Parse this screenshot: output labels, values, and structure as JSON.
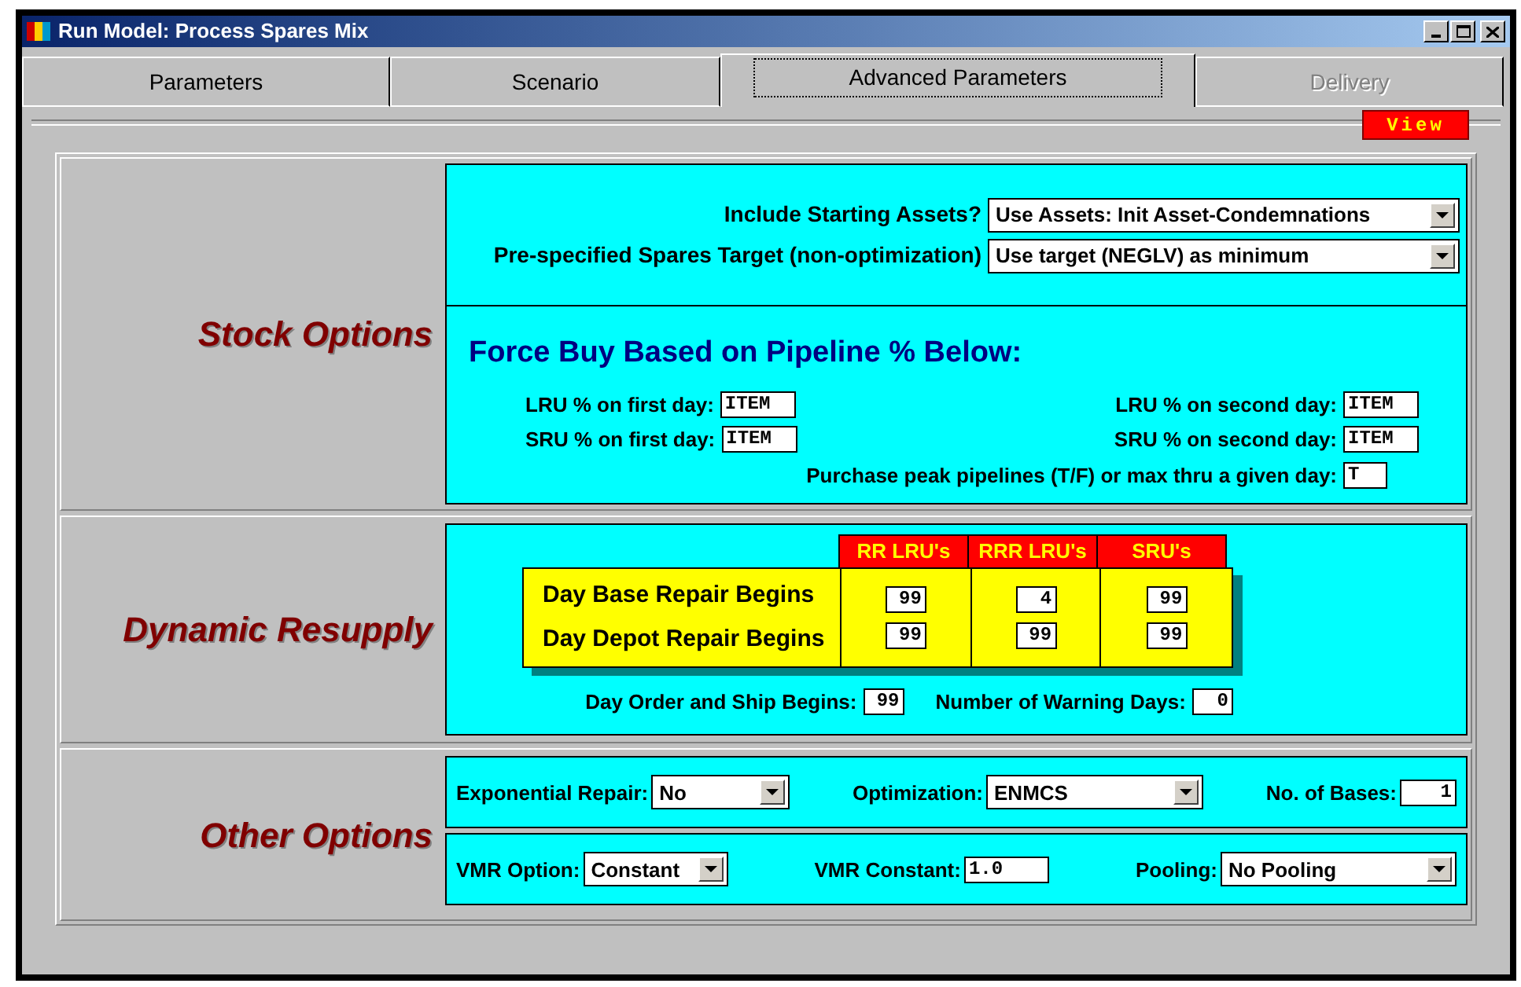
{
  "window": {
    "title": "Run Model: Process Spares Mix"
  },
  "tabs": [
    {
      "label": "Parameters",
      "selected": false,
      "disabled": false
    },
    {
      "label": "Scenario",
      "selected": false,
      "disabled": false
    },
    {
      "label": "Advanced Parameters",
      "selected": true,
      "disabled": false
    },
    {
      "label": "Delivery",
      "selected": false,
      "disabled": true
    }
  ],
  "view_button": "View",
  "stock_options": {
    "title": "Stock Options",
    "dropdowns": [
      {
        "label": "Include Starting Assets?",
        "value": "Use Assets: Init Asset-Condemnations"
      },
      {
        "label": "Pre-specified Spares Target (non-optimization)",
        "value": "Use target (NEGLV) as minimum"
      }
    ],
    "force_buy": {
      "heading": "Force Buy Based on Pipeline % Below:",
      "fields": [
        {
          "label": "LRU % on first day:",
          "value": "ITEM"
        },
        {
          "label": "LRU % on second day:",
          "value": "ITEM"
        },
        {
          "label": "SRU % on first day:",
          "value": "ITEM"
        },
        {
          "label": "SRU % on second day:",
          "value": "ITEM"
        }
      ],
      "peak": {
        "label": "Purchase peak pipelines (T/F) or max thru a given day:",
        "value": "T"
      }
    }
  },
  "dynamic_resupply": {
    "title": "Dynamic Resupply",
    "columns": [
      "RR LRU's",
      "RRR LRU's",
      "SRU's"
    ],
    "rows": [
      {
        "label": "Day Base Repair Begins",
        "values": [
          "99",
          "4",
          "99"
        ]
      },
      {
        "label": "Day Depot Repair Begins",
        "values": [
          "99",
          "99",
          "99"
        ]
      }
    ],
    "order_ship": {
      "label": "Day Order and Ship Begins:",
      "value": "99"
    },
    "warning_days": {
      "label": "Number of Warning Days:",
      "value": "0"
    }
  },
  "other_options": {
    "title": "Other Options",
    "rows": [
      [
        {
          "kind": "dropdown",
          "label": "Exponential Repair:",
          "value": "No"
        },
        {
          "kind": "dropdown",
          "label": "Optimization:",
          "value": "ENMCS"
        },
        {
          "kind": "input",
          "label": "No. of Bases:",
          "value": "1"
        }
      ],
      [
        {
          "kind": "dropdown",
          "label": "VMR Option:",
          "value": "Constant"
        },
        {
          "kind": "input",
          "label": "VMR Constant:",
          "value": "1.0"
        },
        {
          "kind": "dropdown",
          "label": "Pooling:",
          "value": "No Pooling"
        }
      ]
    ]
  }
}
